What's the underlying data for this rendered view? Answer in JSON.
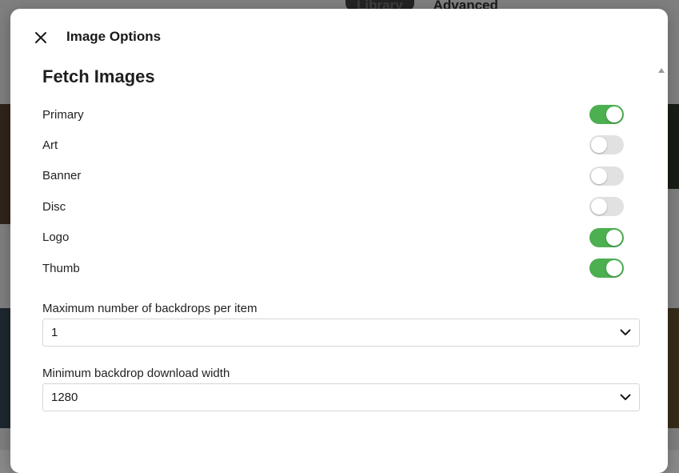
{
  "background": {
    "tabs": [
      {
        "label": "Library",
        "active": true
      },
      {
        "label": "Advanced",
        "active": false
      }
    ]
  },
  "dialog": {
    "title": "Image Options",
    "close_icon": "close-icon",
    "section_title": "Fetch Images",
    "image_types": [
      {
        "label": "Primary",
        "enabled": true
      },
      {
        "label": "Art",
        "enabled": false
      },
      {
        "label": "Banner",
        "enabled": false
      },
      {
        "label": "Disc",
        "enabled": false
      },
      {
        "label": "Logo",
        "enabled": true
      },
      {
        "label": "Thumb",
        "enabled": true
      }
    ],
    "max_backdrops": {
      "label": "Maximum number of backdrops per item",
      "value": "1"
    },
    "min_backdrop_width": {
      "label": "Minimum backdrop download width",
      "value": "1280"
    }
  },
  "colors": {
    "toggle_on": "#4caf50",
    "toggle_off": "#e1e1e1"
  }
}
